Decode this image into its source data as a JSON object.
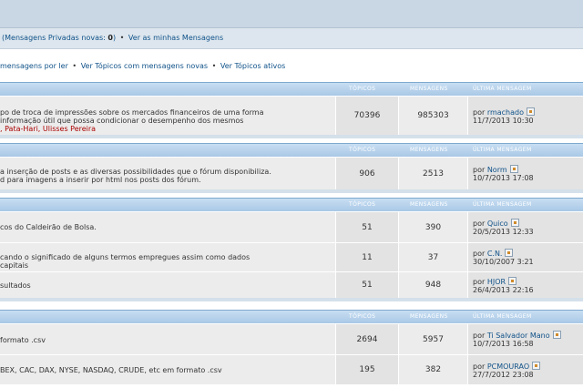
{
  "pm": {
    "label": "(Mensagens Privadas novas:",
    "count": "0",
    "close": ")",
    "bullet": "•",
    "view_link": "Ver as minhas Mensagens"
  },
  "links": {
    "unread": "mensagens por ler",
    "new": "Ver Tópicos com mensagens novas",
    "active": "Ver Tópicos ativos",
    "bullet": "•"
  },
  "columns": {
    "topics": "TÓPICOS",
    "posts": "MENSAGENS",
    "last": "ÚLTIMA MENSAGEM"
  },
  "categories": [
    {
      "forums": [
        {
          "desc1": "po de troca de impressões sobre os mercados financeiros de uma forma",
          "desc2": "informação útil que possa condicionar o desempenho dos mesmos",
          "mods": ", Pata-Hari, Ulisses Pereira",
          "topics": "70396",
          "posts": "985303",
          "last_by": "por",
          "last_user": "rmachado",
          "last_date": "11/7/2013 10:30"
        }
      ]
    },
    {
      "forums": [
        {
          "desc1": "a inserção de posts e as diversas possibilidades que o fórum disponibiliza.",
          "desc2": "d para imagens a inserir por html nos posts dos fórum.",
          "topics": "906",
          "posts": "2513",
          "last_by": "por",
          "last_user": "Norm",
          "last_date": "10/7/2013 17:08"
        }
      ]
    },
    {
      "forums": [
        {
          "desc1": "cos do Caldeirão de Bolsa.",
          "topics": "51",
          "posts": "390",
          "last_by": "por",
          "last_user": "Quico",
          "last_date": "20/5/2013 12:33"
        },
        {
          "desc1": "cando o significado de alguns termos empregues assim como dados",
          "desc2": "capitais",
          "topics": "11",
          "posts": "37",
          "last_by": "por",
          "last_user": "C.N.",
          "last_date": "30/10/2007 3:21"
        },
        {
          "desc1": "sultados",
          "topics": "51",
          "posts": "948",
          "last_by": "por",
          "last_user": "HJOR",
          "last_date": "26/4/2013 22:16"
        }
      ]
    },
    {
      "forums": [
        {
          "desc1": "formato .csv",
          "topics": "2694",
          "posts": "5957",
          "last_by": "por",
          "last_user": "Ti Salvador Mano",
          "last_date": "10/7/2013 16:58"
        },
        {
          "desc1": "BEX, CAC, DAX, NYSE, NASDAQ, CRUDE, etc em formato .csv",
          "topics": "195",
          "posts": "382",
          "last_by": "por",
          "last_user": "PCMOURAO",
          "last_date": "27/7/2012 23:08"
        }
      ]
    }
  ]
}
